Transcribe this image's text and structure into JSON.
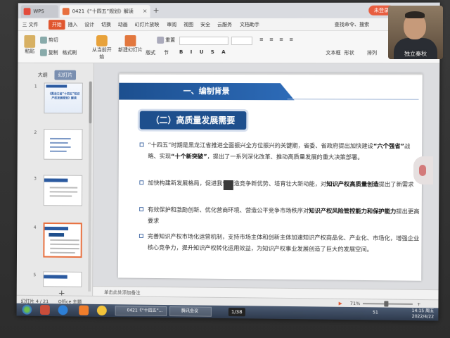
{
  "titlebar": {
    "wps_tab": "WPS",
    "doc_tab": "0421《“十四五”规划》解读",
    "login": "未登录"
  },
  "menu": {
    "items": [
      "三 文件",
      "开始",
      "插入",
      "设计",
      "切换",
      "动画",
      "幻灯片放映",
      "审阅",
      "视图",
      "安全",
      "云服务",
      "文档助手"
    ],
    "search": "查找命令、搜索"
  },
  "ribbon": {
    "paste": "粘贴",
    "cut": "剪切",
    "copy": "复制",
    "format_painter": "格式刷",
    "from_start": "从当前开始",
    "new_slide": "新建幻灯片",
    "layout": "版式",
    "section": "节",
    "reset": "重置",
    "textbox": "文本框",
    "shape": "形状",
    "arrange": "排列",
    "more": "…"
  },
  "leftpanel": {
    "tabs": [
      "大纲",
      "幻灯片"
    ],
    "thumb_numbers": [
      "1",
      "2",
      "3",
      "4",
      "5"
    ],
    "thumb1_text": "《黑龙江省“十四五”知识产权发展规划》解读"
  },
  "slide": {
    "section_title": "一、编制背景",
    "subsection_title": "（二）高质量发展需要",
    "b1_a": "“十四五”时期是黑龙江省推进全面振兴全方位振兴的关键期，省委、省政府提出加快建设",
    "b1_hl1": "“六个强省”",
    "b1_b": "战略、实现",
    "b1_hl2": "“十个新突破”",
    "b1_c": "，提出了一系列深化改革、推动高质量发展的重大决策部署。",
    "b2_a": "加快构建新发展格局，促进我省塑造竞争新优势、培育壮大新动能，对",
    "b2_hl": "知识产权高质量创造",
    "b2_b": "提出了新需求",
    "b3_a": "有效保护和激励创新、优化营商环境、营造公平竞争市场秩序对",
    "b3_hl": "知识产权风险管控能力和保护能力",
    "b3_b": "提出更高要求",
    "b4": "完善知识产权市场化运营机制，支持市场主体和创新主体加速知识产权商品化、产业化、市场化，增强企业核心竞争力，提升知识产权转化运用效益，为知识产权事业发展创造了巨大的发展空间。"
  },
  "notes": {
    "placeholder": "单击此处添加备注"
  },
  "statusbar": {
    "slide_info": "幻灯片 4 / 21",
    "theme": "Office 主题",
    "zoom": "71%"
  },
  "taskbar": {
    "app1": "0421《“十四五”...",
    "app2": "腾讯会议",
    "page_counter": "1/38",
    "clock_time": "14:15 周五",
    "clock_date": "2022/4/22",
    "tray_num": "51"
  },
  "webcam": {
    "name": "独立秦秋"
  },
  "colors": {
    "accent": "#e0562f",
    "banner": "#1e4f8d"
  }
}
